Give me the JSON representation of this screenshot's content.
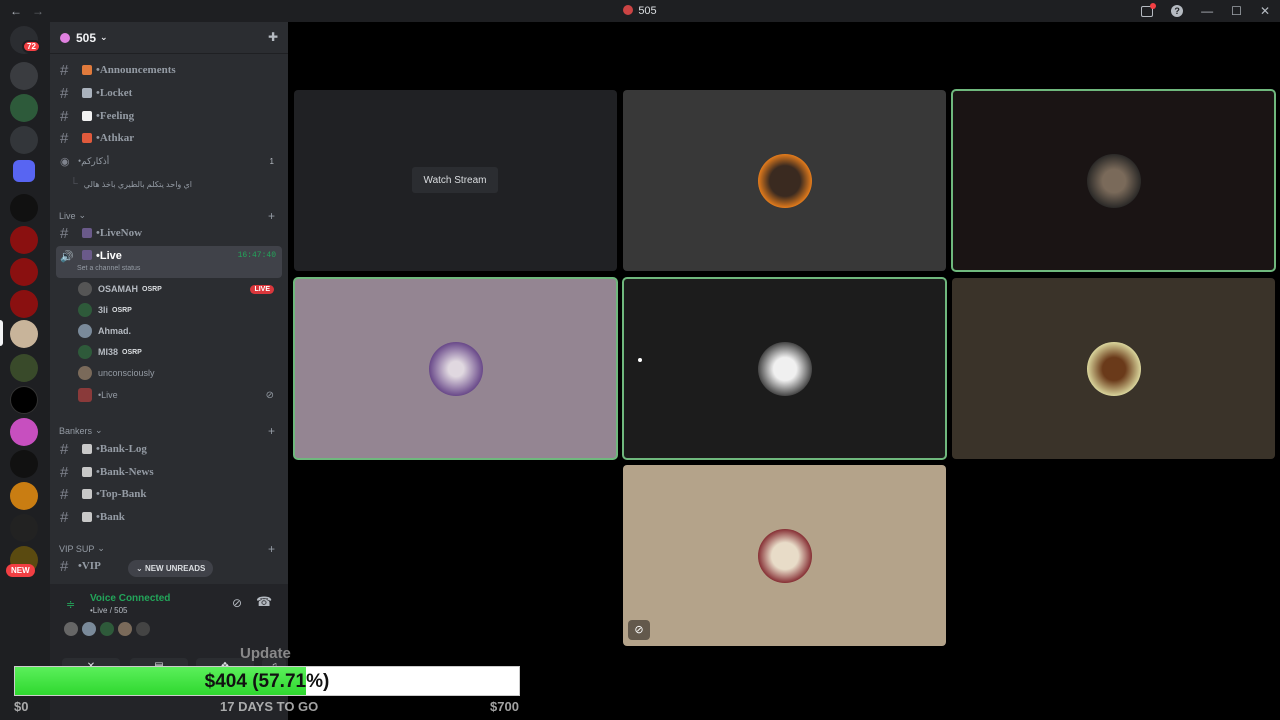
{
  "window": {
    "title": "505",
    "back_glyph": "←",
    "forward_glyph": "→",
    "minimize_glyph": "—",
    "maximize_glyph": "☐",
    "close_glyph": "✕",
    "help_glyph": "?"
  },
  "guilds": {
    "dm_badge": "72",
    "new_badge": "NEW"
  },
  "server": {
    "name": "505"
  },
  "channels_top": [
    {
      "name": "•Announcements",
      "emoji_color": "#e07a3c"
    },
    {
      "name": "•Locket",
      "emoji_color": "#aab2bd"
    },
    {
      "name": "•Feeling",
      "emoji_color": "#f2f2f2"
    },
    {
      "name": "•Athkar",
      "emoji_color": "#e05a3c"
    }
  ],
  "thread": {
    "name": "•أذكاركم",
    "count": "1",
    "preview": "اي واحد يتكلم بالطيري باخذ هالي"
  },
  "live_category": {
    "label": "Live",
    "channels": [
      {
        "name": "•LiveNow"
      },
      {
        "name": "•Live",
        "timer": "16:47:40",
        "status": "Set a channel status"
      }
    ],
    "voice_users": [
      {
        "name": "OSAMAH",
        "tag": "OSRP",
        "live": "LIVE"
      },
      {
        "name": "3li",
        "tag": "OSRP"
      },
      {
        "name": "Ahmad."
      },
      {
        "name": "MI38",
        "tag": "OSRP"
      },
      {
        "name": "unconsciously"
      },
      {
        "name": "•Live"
      }
    ]
  },
  "bankers_category": {
    "label": "Bankers",
    "channels": [
      "•Bank-Log",
      "•Bank-News",
      "•Top-Bank",
      "•Bank"
    ]
  },
  "vip_category": {
    "label": "VIP SUP",
    "channels": [
      "•VIP"
    ]
  },
  "new_unreads": "NEW UNREADS",
  "voice_panel": {
    "title": "Voice Connected",
    "subtitle": "•Live / 505"
  },
  "stage": {
    "watch_label": "Watch Stream",
    "tile_colors": [
      "#202124",
      "#383838",
      "#1a1414",
      "#948592",
      "#1c1c1c",
      "#3a3329",
      "#b4a38a"
    ]
  },
  "overlay": {
    "amount": "$404 (57.71%)",
    "progress_percent": 57.71,
    "start": "$0",
    "goal": "$700",
    "countdown": "17 DAYS TO GO",
    "update_label": "Update"
  }
}
